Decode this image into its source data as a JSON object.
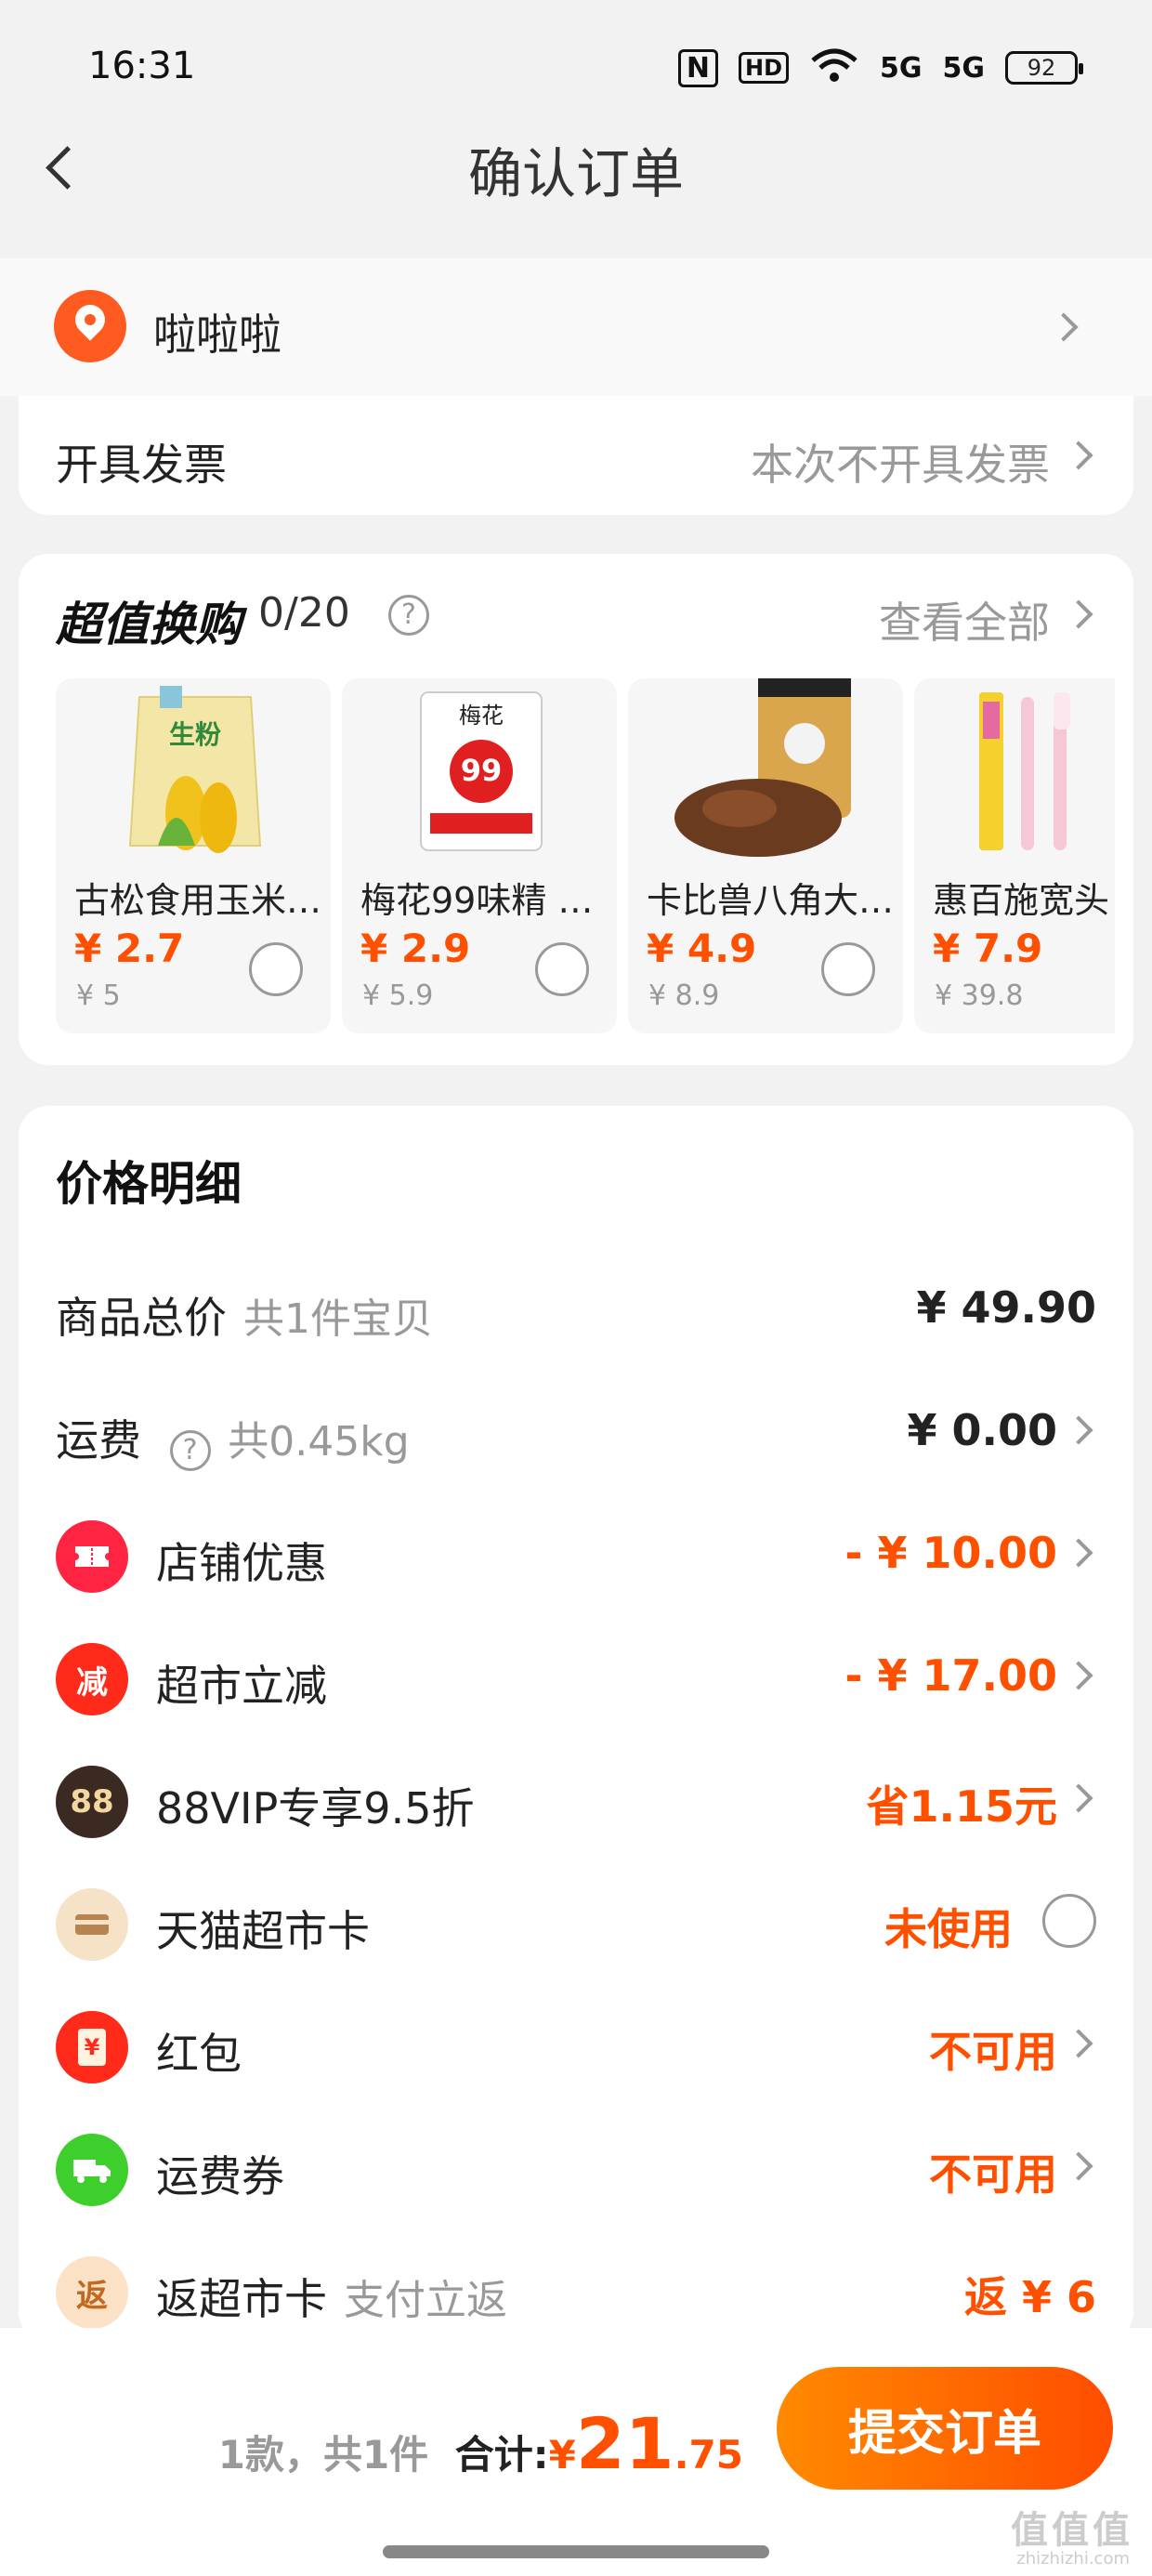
{
  "status_bar": {
    "time": "16:31",
    "nfc": "N",
    "hd": "HD",
    "signal1": "5G",
    "signal2": "5G",
    "battery": "92"
  },
  "nav": {
    "title": "确认订单"
  },
  "address": {
    "name": "啦啦啦"
  },
  "invoice": {
    "label": "开具发票",
    "value": "本次不开具发票"
  },
  "swap": {
    "title": "超值换购",
    "count": "0/20",
    "help": "?",
    "see_all": "查看全部",
    "products": [
      {
        "name": "古松食用玉米…",
        "price": "¥ 2.7",
        "original": "¥ 5",
        "img": "corn-starch-bag"
      },
      {
        "name": "梅花99味精 …",
        "price": "¥ 2.9",
        "original": "¥ 5.9",
        "img": "msg-bag"
      },
      {
        "name": "卡比兽八角大…",
        "price": "¥ 4.9",
        "original": "¥ 8.9",
        "img": "star-anise-jar"
      },
      {
        "name": "惠百施宽头",
        "price": "¥ 7.9",
        "original": "¥ 39.8",
        "img": "toothbrush"
      }
    ]
  },
  "price_detail": {
    "heading": "价格明细",
    "subtotal": {
      "label": "商品总价",
      "sub": "共1件宝贝",
      "value": "¥ 49.90"
    },
    "shipping": {
      "label": "运费",
      "sub": "共0.45kg",
      "value": "¥ 0.00",
      "help": "?"
    },
    "store_discount": {
      "label": "店铺优惠",
      "value": "- ¥ 10.00"
    },
    "market_reduction": {
      "label": "超市立减",
      "value": "- ¥ 17.00",
      "icon_text": "减"
    },
    "vip": {
      "label": "88VIP专享9.5折",
      "value": "省1.15元",
      "icon_text": "88"
    },
    "market_card": {
      "label": "天猫超市卡",
      "value": "未使用"
    },
    "red_packet": {
      "label": "红包",
      "value": "不可用",
      "icon_text": "¥"
    },
    "shipping_coupon": {
      "label": "运费券",
      "value": "不可用"
    },
    "cashback": {
      "label": "返超市卡",
      "sub": "支付立返",
      "value": "返 ¥ 6",
      "icon_text": "返"
    }
  },
  "footer": {
    "summary": "1款，共1件",
    "total_label": "合计:",
    "yen": "¥",
    "total_int": "21",
    "total_dec": ".75",
    "submit": "提交订单",
    "watermark": "值值值",
    "watermark_sub": "zhizhizhi.com"
  },
  "colors": {
    "accent": "#ff5000",
    "background": "#f2f2f2"
  }
}
